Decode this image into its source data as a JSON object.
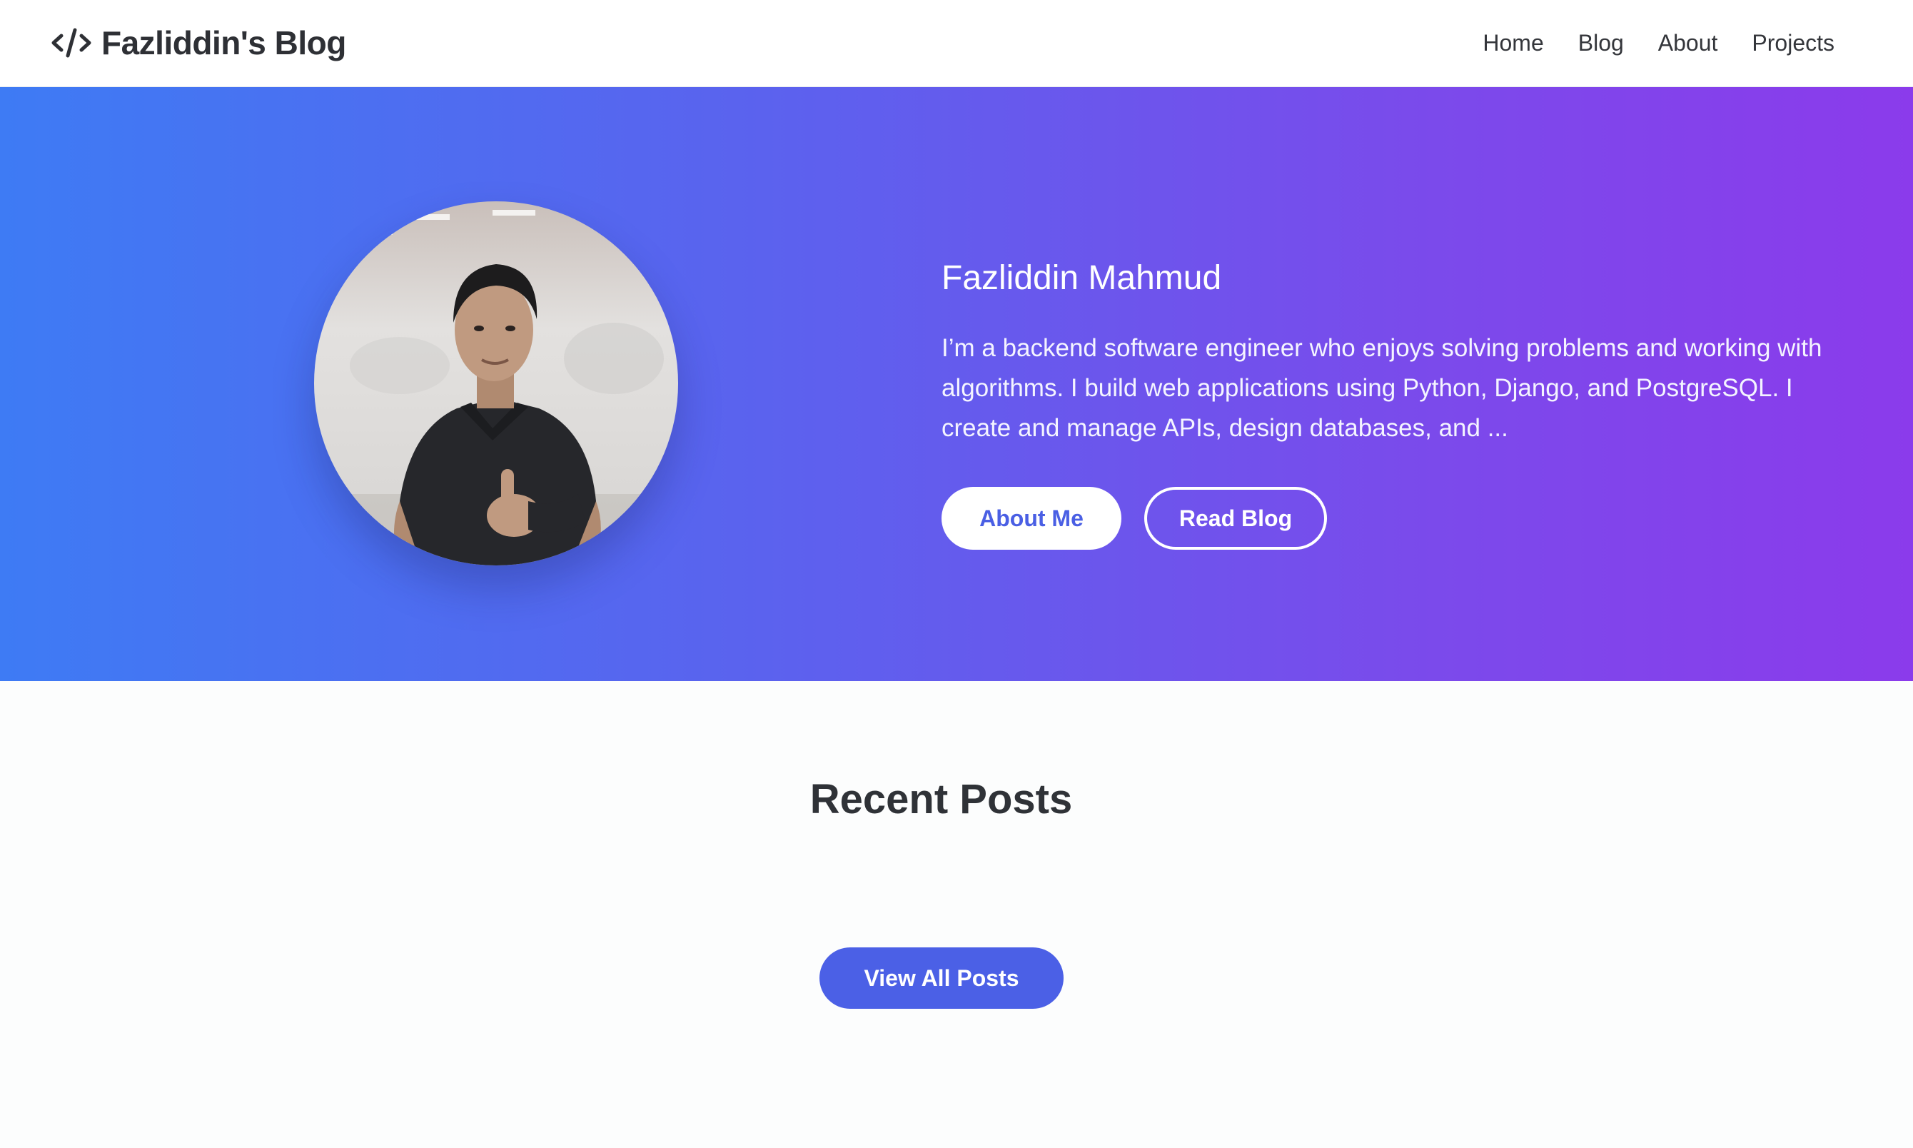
{
  "header": {
    "brand_icon": "code-icon",
    "brand_name": "Fazliddin's Blog",
    "nav": [
      {
        "label": "Home"
      },
      {
        "label": "Blog"
      },
      {
        "label": "About"
      },
      {
        "label": "Projects"
      }
    ]
  },
  "hero": {
    "name": "Fazliddin Mahmud",
    "bio": "I’m a backend software engineer who enjoys solving problems and working with algorithms. I build web applications using Python, Django, and PostgreSQL. I create and manage APIs, design databases, and ...",
    "primary_button": "About Me",
    "secondary_button": "Read Blog",
    "gradient_start": "#3e7bf4",
    "gradient_end": "#8b3beb"
  },
  "recent_posts": {
    "title": "Recent Posts",
    "view_all_label": "View All Posts",
    "accent_color": "#4b60e6"
  }
}
